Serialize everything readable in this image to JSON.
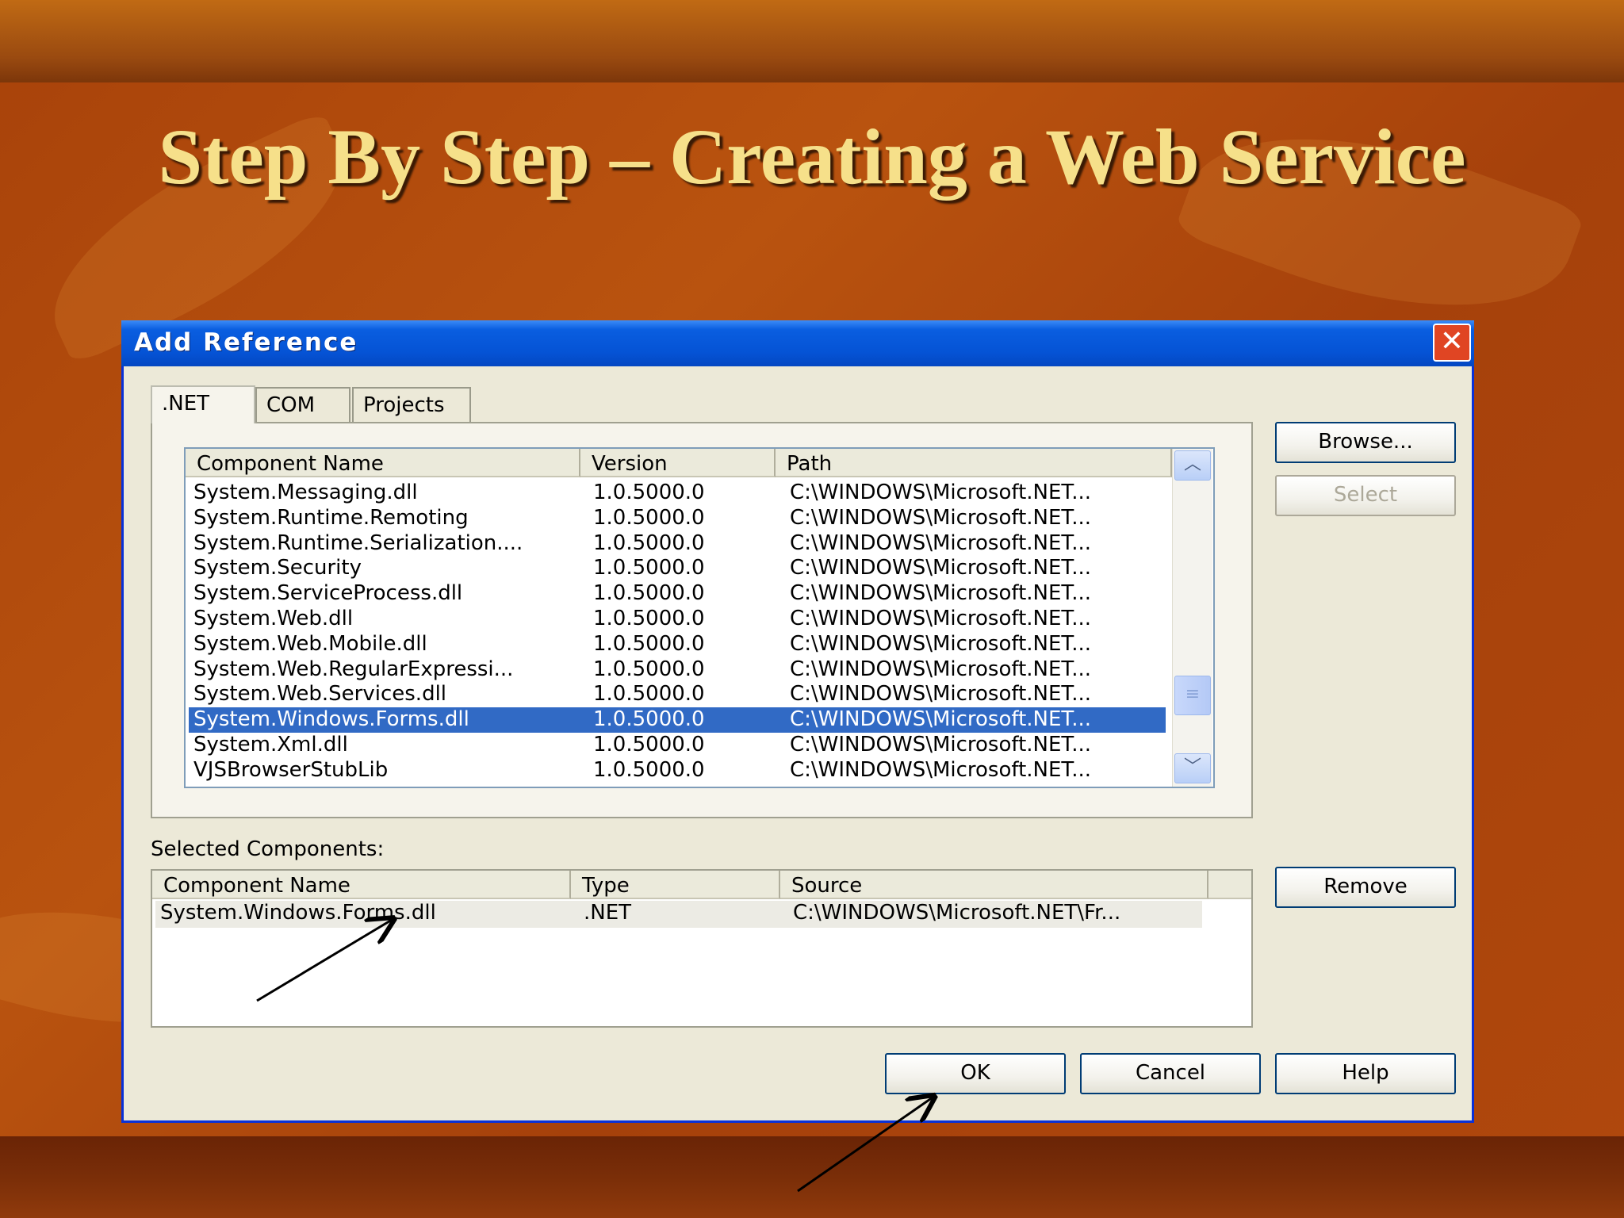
{
  "slide": {
    "title": "Step By Step – Creating a Web Service"
  },
  "dialog": {
    "title": "Add Reference",
    "close_icon": "close-icon",
    "tabs": [
      ".NET",
      "COM",
      "Projects"
    ],
    "active_tab": ".NET",
    "columns": [
      "Component Name",
      "Version",
      "Path"
    ],
    "rows": [
      {
        "name": "System.Messaging.dll",
        "version": "1.0.5000.0",
        "path": "C:\\WINDOWS\\Microsoft.NET..."
      },
      {
        "name": "System.Runtime.Remoting",
        "version": "1.0.5000.0",
        "path": "C:\\WINDOWS\\Microsoft.NET..."
      },
      {
        "name": "System.Runtime.Serialization....",
        "version": "1.0.5000.0",
        "path": "C:\\WINDOWS\\Microsoft.NET..."
      },
      {
        "name": "System.Security",
        "version": "1.0.5000.0",
        "path": "C:\\WINDOWS\\Microsoft.NET..."
      },
      {
        "name": "System.ServiceProcess.dll",
        "version": "1.0.5000.0",
        "path": "C:\\WINDOWS\\Microsoft.NET..."
      },
      {
        "name": "System.Web.dll",
        "version": "1.0.5000.0",
        "path": "C:\\WINDOWS\\Microsoft.NET..."
      },
      {
        "name": "System.Web.Mobile.dll",
        "version": "1.0.5000.0",
        "path": "C:\\WINDOWS\\Microsoft.NET..."
      },
      {
        "name": "System.Web.RegularExpressi...",
        "version": "1.0.5000.0",
        "path": "C:\\WINDOWS\\Microsoft.NET..."
      },
      {
        "name": "System.Web.Services.dll",
        "version": "1.0.5000.0",
        "path": "C:\\WINDOWS\\Microsoft.NET..."
      },
      {
        "name": "System.Windows.Forms.dll",
        "version": "1.0.5000.0",
        "path": "C:\\WINDOWS\\Microsoft.NET..."
      },
      {
        "name": "System.Xml.dll",
        "version": "1.0.5000.0",
        "path": "C:\\WINDOWS\\Microsoft.NET..."
      },
      {
        "name": "VJSBrowserStubLib",
        "version": "1.0.5000.0",
        "path": "C:\\WINDOWS\\Microsoft.NET..."
      }
    ],
    "selected_row": "System.Windows.Forms.dll",
    "buttons": {
      "browse": "Browse...",
      "select": "Select",
      "remove": "Remove",
      "ok": "OK",
      "cancel": "Cancel",
      "help": "Help"
    },
    "selected_components": {
      "label": "Selected Components:",
      "columns": [
        "Component Name",
        "Type",
        "Source"
      ],
      "rows": [
        {
          "name": "System.Windows.Forms.dll",
          "type": ".NET",
          "source": "C:\\WINDOWS\\Microsoft.NET\\Fr..."
        }
      ]
    }
  },
  "colors": {
    "selection": "#316ac5",
    "titlebar": "#0553d5",
    "slide_title": "#f6e08a"
  }
}
